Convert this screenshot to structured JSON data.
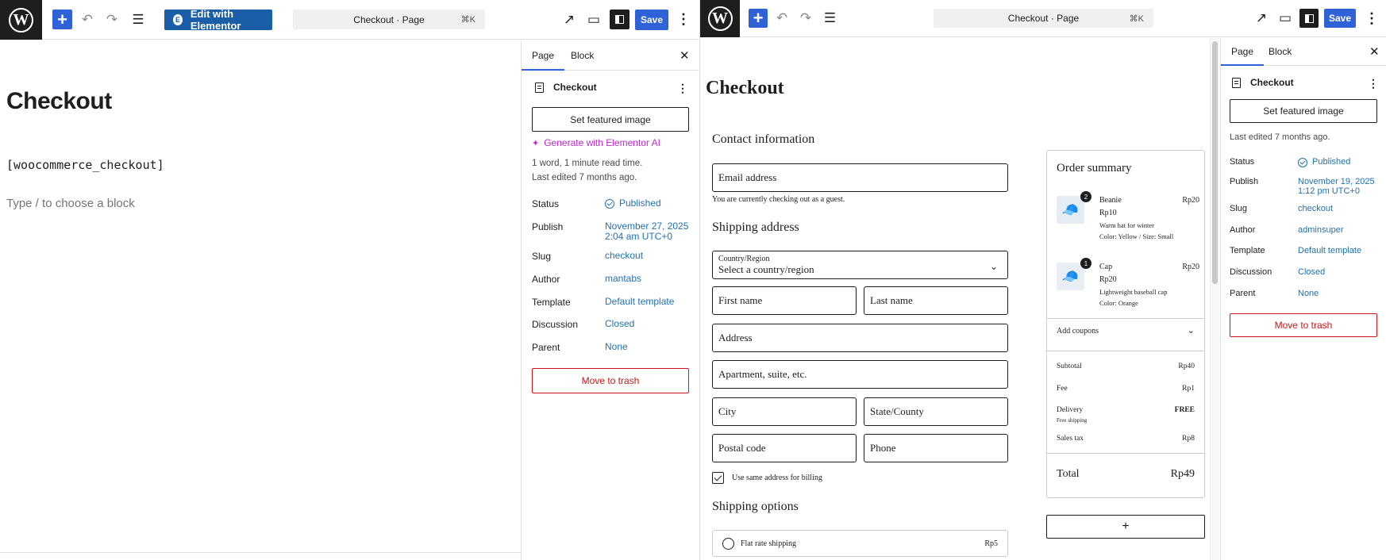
{
  "left": {
    "toolbar": {
      "wp_logo": "W",
      "add": "+",
      "undo": "↶",
      "redo": "↷",
      "list_view": "☰",
      "elementor_label": "Edit with Elementor",
      "elementor_icon": "E",
      "command": "Checkout · Page",
      "shortcut": "⌘K",
      "view": "↗",
      "preview": "▭",
      "save": "Save",
      "more": "⋮"
    },
    "editor": {
      "title": "Checkout",
      "shortcode": "[woocommerce_checkout]",
      "placeholder": "Type / to choose a block"
    },
    "sidebar": {
      "tab_page": "Page",
      "tab_block": "Block",
      "close": "✕",
      "doc_title": "Checkout",
      "doc_more": "⋮",
      "featured": "Set featured image",
      "ai_link": "Generate with Elementor AI",
      "ai_icon": "✦",
      "read_time": "1 word, 1 minute read time.",
      "last_edited": "Last edited 7 months ago.",
      "status_label": "Status",
      "status_value": "Published",
      "publish_label": "Publish",
      "publish_value_1": "November 27, 2025",
      "publish_value_2": "2:04 am UTC+0",
      "slug_label": "Slug",
      "slug_value": "checkout",
      "author_label": "Author",
      "author_value": "mantabs",
      "template_label": "Template",
      "template_value": "Default template",
      "discussion_label": "Discussion",
      "discussion_value": "Closed",
      "parent_label": "Parent",
      "parent_value": "None",
      "trash": "Move to trash"
    }
  },
  "right": {
    "toolbar": {
      "wp_logo": "W",
      "add": "+",
      "undo": "↶",
      "redo": "↷",
      "list_view": "☰",
      "command": "Checkout · Page",
      "shortcut": "⌘K",
      "view": "↗",
      "preview": "▭",
      "save": "Save",
      "more": "⋮"
    },
    "checkout": {
      "title": "Checkout",
      "contact_heading": "Contact information",
      "email_label": "Email address",
      "guest_note": "You are currently checking out as a guest.",
      "shipping_heading": "Shipping address",
      "country_label": "Country/Region",
      "country_value": "Select a country/region",
      "caret": "⌄",
      "first_name": "First name",
      "last_name": "Last name",
      "address": "Address",
      "apartment": "Apartment, suite, etc.",
      "city": "City",
      "state": "State/County",
      "postal": "Postal code",
      "phone": "Phone",
      "same_billing": "Use same address for billing",
      "shipping_options_heading": "Shipping options",
      "flat_rate_label": "Flat rate shipping",
      "flat_rate_price": "Rp5"
    },
    "summary": {
      "heading": "Order summary",
      "items": [
        {
          "qty": "2",
          "name": "Beanie",
          "price": "Rp20",
          "unit": "Rp10",
          "desc": "Warm hat for winter",
          "attrs": "Color: Yellow / Size: Small",
          "icon": "🧢"
        },
        {
          "qty": "1",
          "name": "Cap",
          "price": "Rp20",
          "unit": "Rp20",
          "desc": "Lightweight baseball cap",
          "attrs": "Color: Orange",
          "icon": "🧢"
        }
      ],
      "coupons": "Add coupons",
      "coupons_caret": "⌄",
      "subtotal_label": "Subtotal",
      "subtotal_value": "Rp40",
      "fee_label": "Fee",
      "fee_value": "Rp1",
      "delivery_label": "Delivery",
      "delivery_value": "FREE",
      "delivery_sub": "Free shipping",
      "tax_label": "Sales tax",
      "tax_value": "Rp8",
      "total_label": "Total",
      "total_value": "Rp49",
      "add_block": "+"
    },
    "sidebar": {
      "tab_page": "Page",
      "tab_block": "Block",
      "close": "✕",
      "doc_title": "Checkout",
      "doc_more": "⋮",
      "featured": "Set featured image",
      "last_edited": "Last edited 7 months ago.",
      "status_label": "Status",
      "status_value": "Published",
      "publish_label": "Publish",
      "publish_value_1": "November 19, 2025",
      "publish_value_2": "1:12 pm UTC+0",
      "slug_label": "Slug",
      "slug_value": "checkout",
      "author_label": "Author",
      "author_value": "adminsuper",
      "template_label": "Template",
      "template_value": "Default template",
      "discussion_label": "Discussion",
      "discussion_value": "Closed",
      "parent_label": "Parent",
      "parent_value": "None",
      "trash": "Move to trash"
    }
  }
}
